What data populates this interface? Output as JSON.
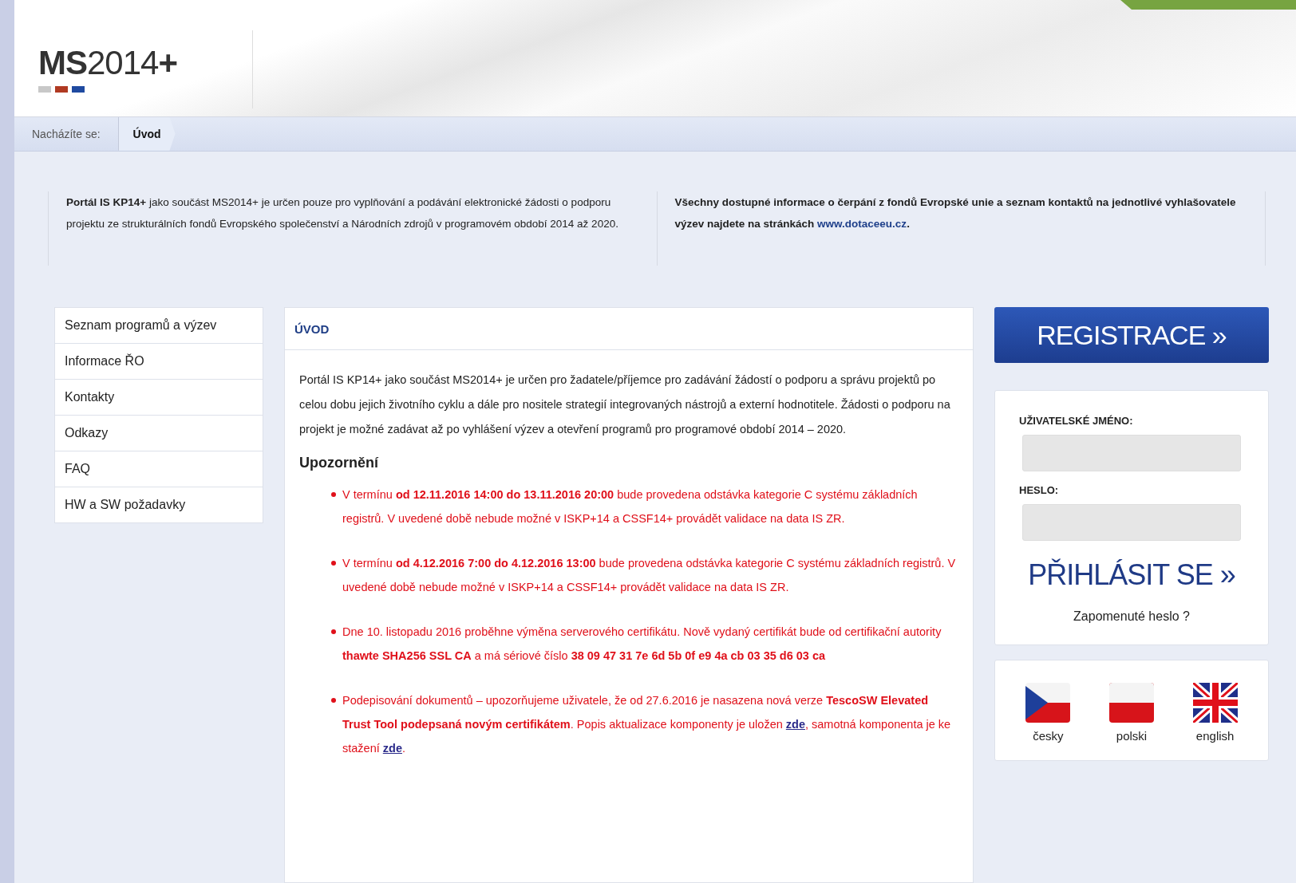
{
  "header": {
    "logo": "**MS**2014**+**"
  },
  "breadcrumb": {
    "label": "Nacházíte se:",
    "items": [
      {
        "label": "Úvod"
      }
    ]
  },
  "intro": {
    "left": "**Portál IS KP14+** jako součást MS2014+ je určen pouze pro vyplňování a podávání elektronické žádosti o podporu projektu ze strukturálních fondů Evropského společenství a Národních zdrojů v programovém období 2014 až 2020.",
    "right": {
      "text": "Všechny dostupné informace o čerpání z fondů Evropské unie a seznam kontaktů na jednotlivé vyhlašovatele výzev najdete na stránkách",
      "link": "www.dotaceeu.cz",
      "end": "."
    }
  },
  "sidebar": {
    "items": [
      {
        "label": "Seznam programů a výzev"
      },
      {
        "label": "Informace ŘO"
      },
      {
        "label": "Kontakty"
      },
      {
        "label": "Odkazy"
      },
      {
        "label": "FAQ"
      },
      {
        "label": "HW a SW požadavky"
      }
    ]
  },
  "content": {
    "title": "ÚVOD",
    "paragraph": "Portál IS KP14+ jako součást MS2014+ je určen pro žadatele/příjemce pro zadávání žádostí o podporu a správu projektů po celou dobu jejich životního cyklu a dále pro nositele strategií integrovaných nástrojů a externí hodnotitele. Žádosti o podporu na projekt je možné zadávat až po vyhlášení výzev a otevření programů pro programové období 2014 – 2020.",
    "notice_heading": "Upozornění",
    "notices": [
      [
        {
          "kind": "text",
          "text": "V termínu **od 12.11.2016 14:00 do 13.11.2016 20:00** bude provedena odstávka kategorie C systému základních registrů. V uvedené době nebude možné v ISKP+14 a CSSF14+ provádět validace na data IS ZR."
        }
      ],
      [
        {
          "kind": "text",
          "text": "V termínu **od 4.12.2016 7:00 do 4.12.2016 13:00** bude provedena odstávka kategorie C systému základních registrů. V uvedené době nebude možné v ISKP+14 a CSSF14+ provádět validace na data IS ZR."
        }
      ],
      [
        {
          "kind": "text",
          "text": "Dne 10. listopadu 2016 proběhne výměna serverového certifikátu. Nově vydaný certifikát bude od certifikační autority **thawte SHA256 SSL CA** a má sériové číslo **38 09 47 31 7e 6d 5b 0f e9 4a cb 03 35 d6 03 ca**"
        }
      ],
      [
        {
          "kind": "text",
          "text": "Podepisování dokumentů – upozorňujeme uživatele, že od 27.6.2016 je nasazena nová verze **TescoSW Elevated Trust Tool podepsaná novým certifikátem**. Popis aktualizace komponenty je uložen "
        },
        {
          "kind": "link",
          "text": "zde"
        },
        {
          "kind": "text",
          "text": ", samotná komponenta je ke stažení "
        },
        {
          "kind": "link",
          "text": "zde"
        },
        {
          "kind": "text",
          "text": "."
        }
      ]
    ]
  },
  "login": {
    "register_button": "REGISTRACE »",
    "username_label": "UŽIVATELSKÉ JMÉNO:",
    "password_label": "HESLO:",
    "login_button": "PŘIHLÁSIT SE »",
    "forgot_link": "Zapomenuté heslo ?"
  },
  "languages": [
    {
      "kind": "cz",
      "label": "česky"
    },
    {
      "kind": "pl",
      "label": "polski"
    },
    {
      "kind": "uk",
      "label": "english"
    }
  ]
}
